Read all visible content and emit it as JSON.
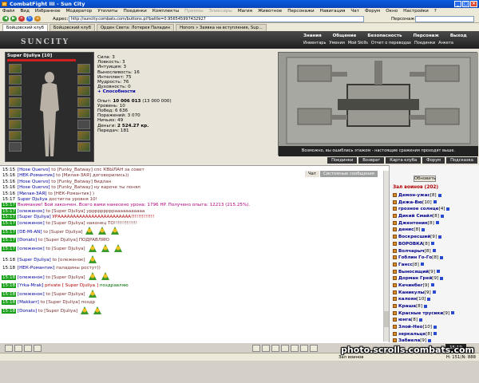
{
  "window": {
    "title": "CombatFight III - Sun City"
  },
  "menu": [
    "Файл",
    "Вид",
    "Избранное",
    "Модератор",
    "Утилиты",
    "Поединки",
    "Комплекты",
    "Приемы",
    "Эликсиры",
    "Магия",
    "Животное",
    "Персонажи",
    "Навигация",
    "Чат",
    "Форум",
    "Окно",
    "Настройки",
    "?"
  ],
  "menu_disabled": [
    false,
    false,
    false,
    false,
    false,
    false,
    false,
    true,
    true,
    false,
    false,
    false,
    false,
    false,
    false,
    false,
    false,
    false
  ],
  "address": {
    "label": "Адрес:",
    "url": "http://suncity.combats.com/buttons.pl?battle=0.956545997432927",
    "persoval_label": "Персонаж:"
  },
  "tabs": [
    "Бойцовский клуб",
    "Бойцовский клуб",
    "Орден Света: Лотерея Паладин",
    "Honors » Заявка на вступление, Sup..."
  ],
  "game": {
    "logo": "SUNCITY",
    "nav": [
      "Знания",
      "Общение",
      "Безопасность",
      "Персонаж",
      "Выход"
    ],
    "subnav": [
      "Инвентарь",
      "Умения",
      "Мой Skills",
      "Отчет о переводах",
      "Поединки",
      "Анкета"
    ],
    "char_name": "Super Djuliya",
    "char_level": "[10]",
    "stats": [
      "Сила: 3",
      "Ловкость: 3",
      "Интуиция: 3",
      "Выносливость: 16",
      "Интеллект: 75",
      "Мудрость: 76",
      "Духовность: 0"
    ],
    "abilities": "+ Способности",
    "exp_label": "Опыт:",
    "exp_value": "10 006 013",
    "exp_next": "(13 000 000)",
    "extra": [
      "Уровень: 10",
      "Побед: 6 636",
      "Поражений: 3 070",
      "Ничьих: 49"
    ],
    "money_label": "Деньги:",
    "money_value": "2 524.27 кр.",
    "transfers": "Передач: 181",
    "map_caption": "Возможно, вы ошиблись этажом - настоящие сражения проходят выше.",
    "map_buttons": [
      "Поединки",
      "Возврат",
      "Карта клуба",
      "Форум",
      "Подсказка"
    ]
  },
  "chat": {
    "tabs": [
      "Чат",
      "Системные сообщения"
    ],
    "lines": [
      {
        "time": "15:15",
        "hl": false,
        "parts": [
          [
            "nick",
            "[Hose Quervo]"
          ],
          [
            "to",
            " to [Funky_Batway] спс КВЫЛАН за совет"
          ]
        ]
      },
      {
        "time": "15:16",
        "hl": false,
        "parts": [
          [
            "nick",
            "[НЕК-Романтик]"
          ],
          [
            "to",
            " to [Милая-ЗАЯ] договорились))"
          ]
        ]
      },
      {
        "time": "15:16",
        "hl": false,
        "parts": [
          [
            "nick",
            "[Hose Quervo]"
          ],
          [
            "to",
            " to [Funky_Batway] бидлан"
          ]
        ]
      },
      {
        "time": "15:16",
        "hl": false,
        "parts": [
          [
            "nick",
            "[Hose Quervo]"
          ],
          [
            "to",
            " to [Funky_Batway] ну кароче ты понял"
          ]
        ]
      },
      {
        "time": "15:16",
        "hl": false,
        "parts": [
          [
            "nick",
            "[Милая-ЗАЯ]"
          ],
          [
            "to",
            " to [НЕК-Романтик] )"
          ]
        ]
      },
      {
        "time": "15:17",
        "hl": false,
        "parts": [
          [
            "nick",
            "Super Djuliya"
          ],
          [
            "to",
            " достигла уровня 10!"
          ]
        ]
      },
      {
        "time": "15:17",
        "hl": true,
        "parts": [
          [
            "sys",
            "Внимание! Бой закончен. Всего вами нанесено урона: 1796 HP. Получено опыта: 12213 (215.25%)."
          ]
        ]
      },
      {
        "time": "15:17",
        "hl": true,
        "parts": [
          [
            "nick",
            "[олеженок]"
          ],
          [
            "to",
            " to [Super Djuliya] урррррррррааааааааааа"
          ]
        ]
      },
      {
        "time": "15:17",
        "hl": true,
        "parts": [
          [
            "nick",
            "[Super Djuliya]"
          ],
          [
            "priv",
            " УРАААААААААААААААААААААААА!!!!!!!!!!!!!"
          ]
        ]
      },
      {
        "time": "15:17",
        "hl": true,
        "parts": [
          [
            "nick",
            "[олеженок]"
          ],
          [
            "to",
            " to [Super Djuliya] наконец ТО!!!!!!!!!!!!!"
          ]
        ]
      },
      {
        "time": "15:17",
        "hl": true,
        "parts": [
          [
            "nick",
            "[DE-MI-AN]"
          ],
          [
            "to",
            " to [Super Djuliya]"
          ]
        ],
        "smiles": 3
      },
      {
        "time": "15:17",
        "hl": true,
        "parts": [
          [
            "nick",
            "[Donats]"
          ],
          [
            "to",
            " to [Super Djuliya] ПОДРАВЛЯЮ"
          ]
        ]
      },
      {
        "time": "15:17",
        "hl": true,
        "parts": [
          [
            "nick",
            "[олеженок]"
          ],
          [
            "to",
            " to [Super Djuliya]"
          ]
        ],
        "smiles": 3
      },
      {
        "time": "15:18",
        "hl": false,
        "parts": [
          [
            "nick",
            "[Super Djuliya]"
          ],
          [
            "to",
            " to [олеженок]"
          ]
        ],
        "smiles": 1
      },
      {
        "time": "15:18",
        "hl": false,
        "parts": [
          [
            "nick",
            "[НЕК-Романтик]"
          ],
          [
            "to",
            " паладины ростут))"
          ]
        ]
      },
      {
        "time": "15:18",
        "hl": true,
        "parts": [
          [
            "nick",
            "[олеженок]"
          ],
          [
            "to",
            " to [Super Djuliya]"
          ]
        ],
        "smiles": 2
      },
      {
        "time": "15:18",
        "hl": true,
        "parts": [
          [
            "nick",
            "[Yrka-Mrak]"
          ],
          [
            "priv",
            " private [ Super Djuliya ]"
          ],
          [
            "green",
            " поздравляю"
          ]
        ]
      },
      {
        "time": "15:18",
        "hl": true,
        "parts": [
          [
            "nick",
            "[олеженок]"
          ],
          [
            "to",
            " to [Super Djuliya]"
          ]
        ],
        "smiles": 1
      },
      {
        "time": "15:18",
        "hl": true,
        "parts": [
          [
            "nick",
            "[Makkarr]"
          ],
          [
            "to",
            " to [Super Djuliya] поздр"
          ]
        ]
      },
      {
        "time": "15:18",
        "hl": true,
        "parts": [
          [
            "nick",
            "[Donats]"
          ],
          [
            "to",
            " to [Super Djuliya]"
          ]
        ],
        "smiles": 2
      }
    ]
  },
  "sidebar": {
    "refresh": "Обновить",
    "hall_title": "Зал воинов (202)",
    "users": [
      {
        "name": "Демон-ужас",
        "lvl": "[8]"
      },
      {
        "name": "Дежа-Вю",
        "lvl": "[10]"
      },
      {
        "name": "грозное солнце",
        "lvl": "[4]"
      },
      {
        "name": "Дикий Смайл",
        "lvl": "[8]"
      },
      {
        "name": "Джентоник",
        "lvl": "[8]"
      },
      {
        "name": "денис",
        "lvl": "[8]"
      },
      {
        "name": "Воскресший",
        "lvl": "[9]"
      },
      {
        "name": "ВОРОВКА",
        "lvl": "[8]"
      },
      {
        "name": "Волчарыч",
        "lvl": "[8]"
      },
      {
        "name": "Гоблин Го-Го",
        "lvl": "[8]"
      },
      {
        "name": "Гансс",
        "lvl": "[8]"
      },
      {
        "name": "Выносящий",
        "lvl": "[9]"
      },
      {
        "name": "Дорман Грей",
        "lvl": "[9]"
      },
      {
        "name": "Кечинбег",
        "lvl": "[9]"
      },
      {
        "name": "Каникулы",
        "lvl": "[9]"
      },
      {
        "name": "калоян",
        "lvl": "[10]"
      },
      {
        "name": "Краша",
        "lvl": "[8]"
      },
      {
        "name": "Красные трусики",
        "lvl": "[9]"
      },
      {
        "name": "юнга",
        "lvl": "[8]"
      },
      {
        "name": "Злой-Нео",
        "lvl": "[10]"
      },
      {
        "name": "зеркальце",
        "lvl": "[8]"
      },
      {
        "name": "Забиела",
        "lvl": "[9]"
      }
    ]
  },
  "bottombar": {
    "clock": "15:19"
  },
  "status": {
    "zone": "Зал воинов",
    "zoom": "Н: 151(N: 888"
  },
  "watermark": "photo.scrolls.combats.com",
  "colors": {
    "titlebar": "#0a5ce0",
    "chat_hl": "#18a018",
    "nick": "#0000a0",
    "system": "#b0007a",
    "private": "#b00000"
  }
}
